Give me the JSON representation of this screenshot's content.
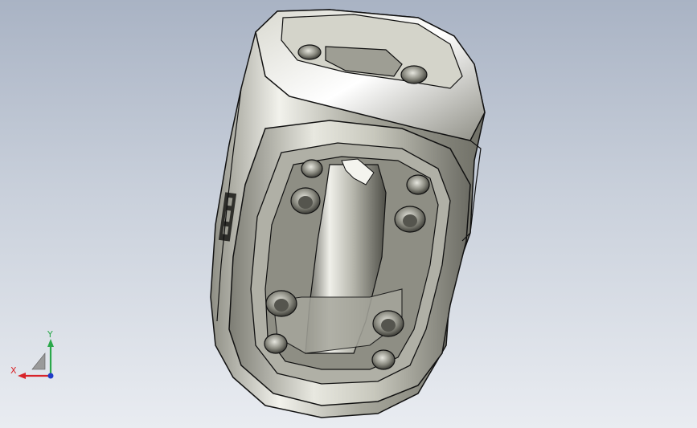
{
  "viewport": {
    "background_top": "#a9b3c4",
    "background_bottom": "#e9ecf1"
  },
  "model": {
    "part_color": "#b9b9ad",
    "edge_color": "#111111"
  },
  "triad": {
    "x_label": "X",
    "y_label": "Y",
    "x_color": "#d8242a",
    "y_color": "#2aa84a",
    "z_color": "#1f3cc8"
  }
}
